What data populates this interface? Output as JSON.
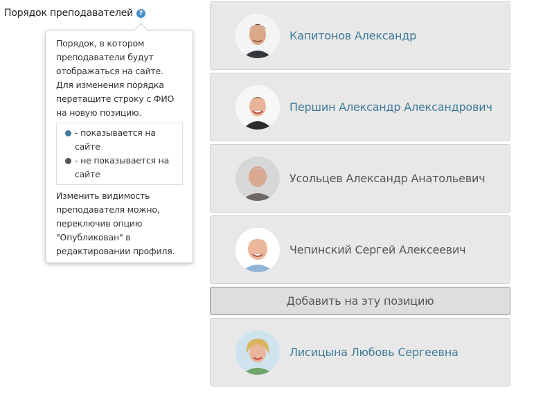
{
  "section": {
    "label": "Порядок преподавателей",
    "help_icon": "question-circle-icon"
  },
  "tooltip": {
    "intro": "Порядок, в котором преподаватели будут отображаться на сайте. Для изменения порядка перетащите строку с ФИО на новую позицию.",
    "legend": [
      {
        "text": "- показывается на сайте",
        "color": "#3f7a99"
      },
      {
        "text": "- не показывается на сайте",
        "color": "#555555"
      }
    ],
    "outro": "Изменить видимость преподавателя можно, переключив опцию \"Опубликован\" в редактировании профиля."
  },
  "teachers": [
    {
      "name": "Капитонов Александр",
      "published": true,
      "avatar": "photo-man-dark-hair-smiling"
    },
    {
      "name": "Першин Александр Александрович",
      "published": true,
      "avatar": "photo-man-light-hair-smiling"
    },
    {
      "name": "Усольцев Александр Анатольевич",
      "published": false,
      "avatar": "photo-older-man-gray-beard"
    },
    {
      "name": "Чепинский Сергей Алексеевич",
      "published": false,
      "avatar": "photo-man-blond-hair"
    }
  ],
  "add_button": {
    "label": "Добавить на эту позицию"
  },
  "teachers_after": [
    {
      "name": "Лисицына Любовь Сергеевна",
      "published": true,
      "avatar": "photo-woman-blond-hair"
    }
  ],
  "colors": {
    "published_name": "#3f7a99",
    "hidden_name": "#555555",
    "card_bg": "#e8e8e8",
    "help_icon": "#4a90c8"
  }
}
